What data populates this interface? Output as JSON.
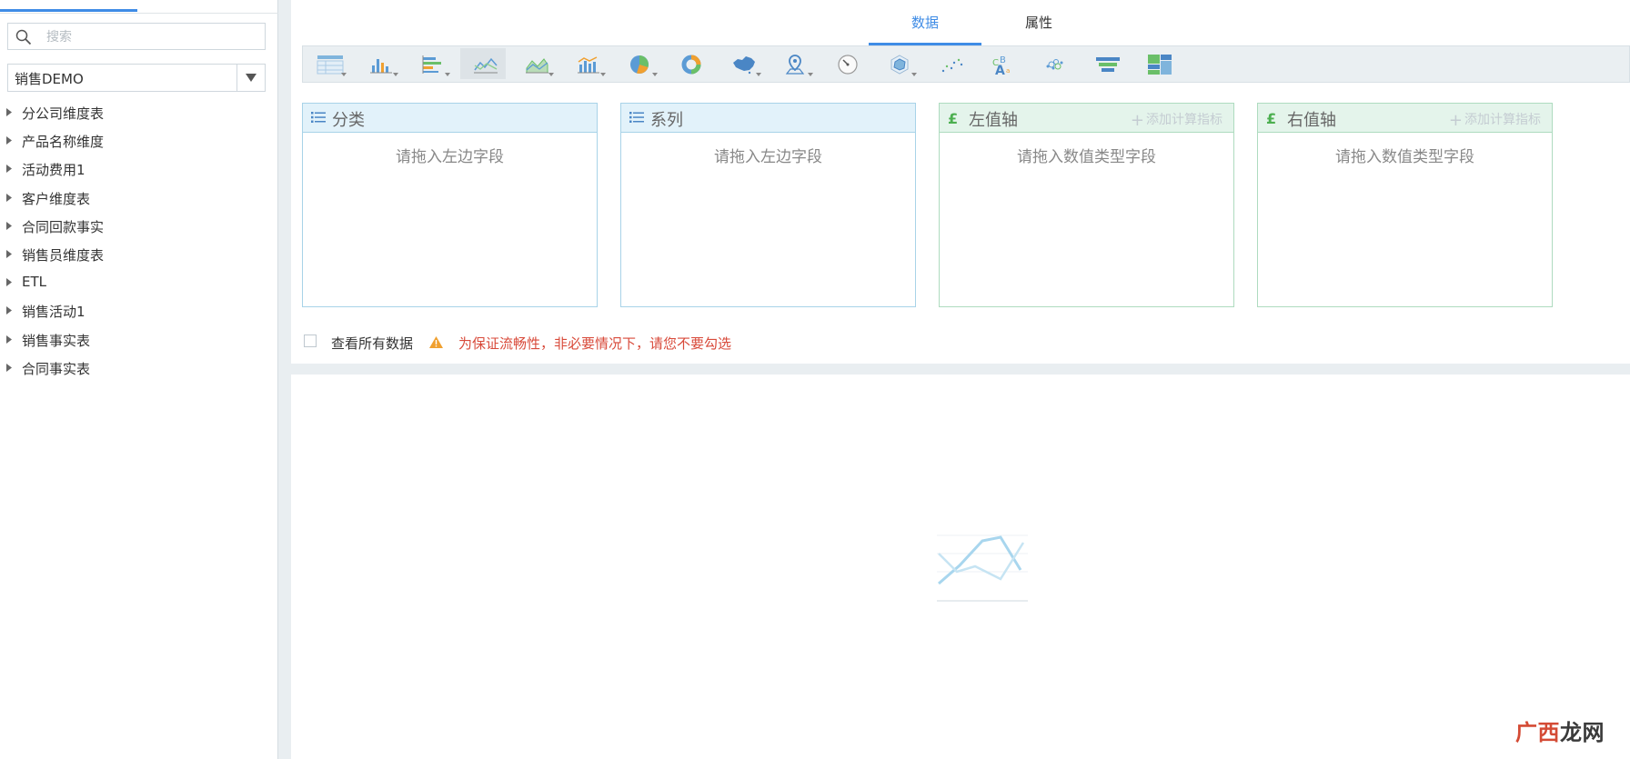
{
  "left_panel": {
    "search": {
      "placeholder": "搜索",
      "value": ""
    },
    "database": {
      "selected": "销售DEMO"
    },
    "tree": [
      {
        "label": "分公司维度表"
      },
      {
        "label": "产品名称维度"
      },
      {
        "label": "活动费用1"
      },
      {
        "label": "客户维度表"
      },
      {
        "label": "合同回款事实"
      },
      {
        "label": "销售员维度表"
      },
      {
        "label": "ETL"
      },
      {
        "label": "销售活动1"
      },
      {
        "label": "销售事实表"
      },
      {
        "label": "合同事实表"
      }
    ]
  },
  "tabs": [
    {
      "label": "数据",
      "active": true
    },
    {
      "label": "属性",
      "active": false
    }
  ],
  "toolbar": {
    "selected": "line-chart-icon",
    "icons": [
      "table-icon",
      "column-chart-icon",
      "bar-chart-icon",
      "line-chart-icon",
      "area-chart-icon",
      "combo-chart-icon",
      "pie-chart-icon",
      "donut-chart-icon",
      "map-icon",
      "gis-map-icon",
      "gauge-icon",
      "radar-chart-icon",
      "scatter-chart-icon",
      "word-cloud-icon",
      "bubble-chart-icon",
      "funnel-chart-icon",
      "treemap-icon"
    ]
  },
  "panels": {
    "category": {
      "title": "分类",
      "hint": "请拖入左边字段"
    },
    "series": {
      "title": "系列",
      "hint": "请拖入左边字段"
    },
    "left_axis": {
      "title": "左值轴",
      "hint": "请拖入数值类型字段",
      "add_label": "添加计算指标"
    },
    "right_axis": {
      "title": "右值轴",
      "hint": "请拖入数值类型字段",
      "add_label": "添加计算指标"
    }
  },
  "view_all": {
    "label": "查看所有数据",
    "checked": false,
    "warning": "为保证流畅性，非必要情况下，请您不要勾选"
  },
  "watermark": {
    "part1": "广西",
    "part2": "龙网"
  },
  "colors": {
    "accent": "#3f8ce6",
    "warning": "#d84a3a",
    "icon_orange": "#f0a030"
  }
}
